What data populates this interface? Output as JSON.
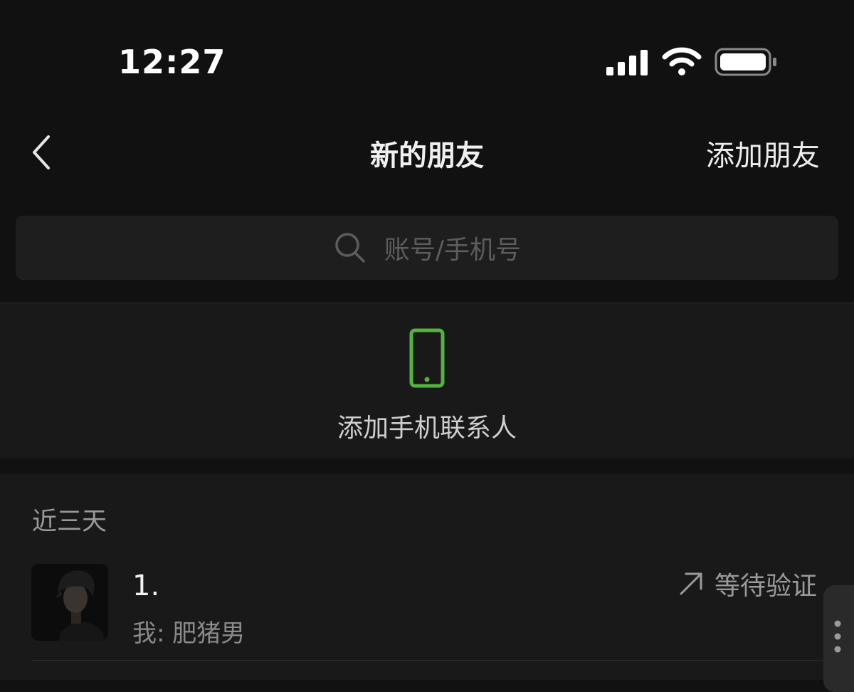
{
  "status_bar": {
    "time": "12:27"
  },
  "nav": {
    "back_icon": "chevron-left-icon",
    "title": "新的朋友",
    "action": "添加朋友"
  },
  "search": {
    "icon": "search-icon",
    "placeholder": "账号/手机号"
  },
  "add_contacts": {
    "icon": "phone-icon",
    "label": "添加手机联系人",
    "icon_color": "#53b33e"
  },
  "recent": {
    "header": "近三天",
    "items": [
      {
        "name": "1.",
        "message": "我: 肥猪男",
        "status": "等待验证",
        "status_icon": "arrow-up-right-icon"
      }
    ]
  },
  "colors": {
    "background": "#111111",
    "section": "#191919",
    "accent": "#53b33e"
  }
}
